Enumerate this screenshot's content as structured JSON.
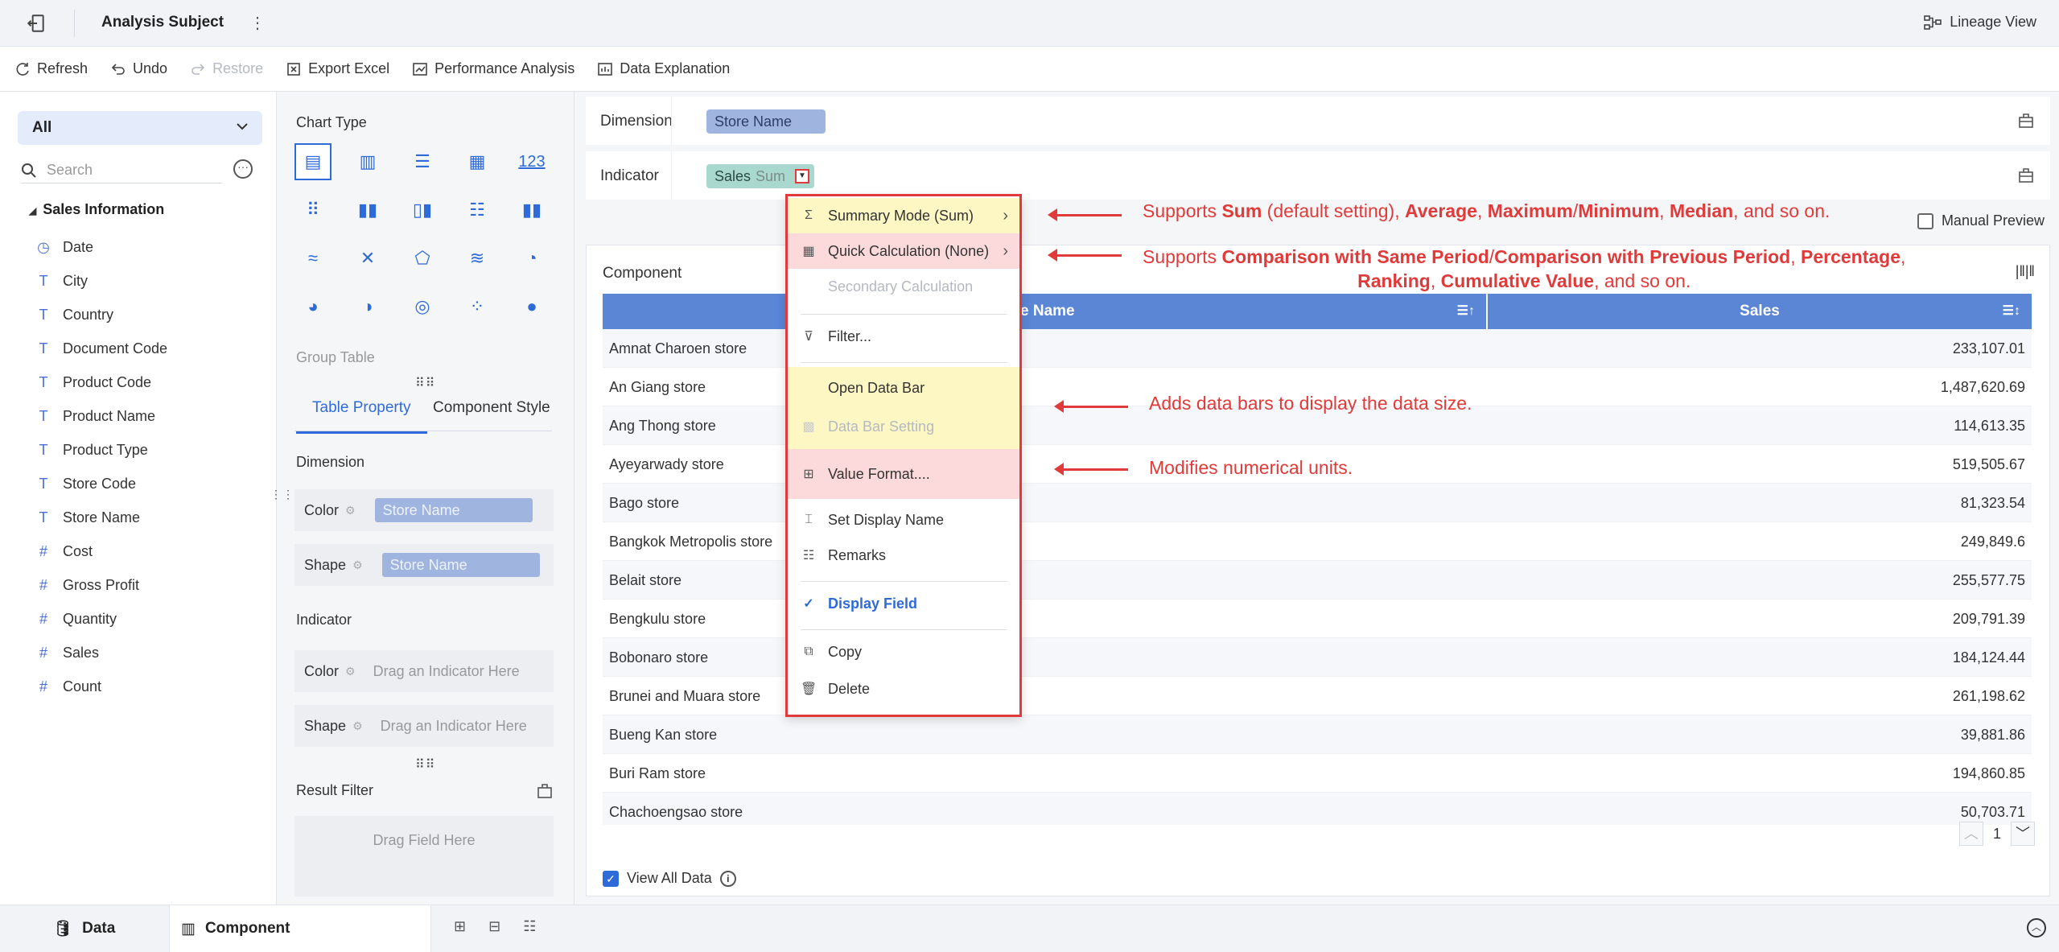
{
  "window": {
    "title": "Analysis Subject",
    "lineage_label": "Lineage View"
  },
  "toolbar": {
    "refresh": "Refresh",
    "undo": "Undo",
    "restore": "Restore",
    "export_excel": "Export Excel",
    "performance_analysis": "Performance Analysis",
    "data_explanation": "Data Explanation"
  },
  "left_panel": {
    "scope_select": "All",
    "search_placeholder": "Search",
    "folder": "Sales Information",
    "fields": [
      {
        "name": "Date",
        "type": "date"
      },
      {
        "name": "City",
        "type": "text"
      },
      {
        "name": "Country",
        "type": "text"
      },
      {
        "name": "Document Code",
        "type": "text"
      },
      {
        "name": "Product Code",
        "type": "text"
      },
      {
        "name": "Product Name",
        "type": "text"
      },
      {
        "name": "Product Type",
        "type": "text"
      },
      {
        "name": "Store Code",
        "type": "text"
      },
      {
        "name": "Store Name",
        "type": "text"
      },
      {
        "name": "Cost",
        "type": "number"
      },
      {
        "name": "Gross Profit",
        "type": "number"
      },
      {
        "name": "Quantity",
        "type": "number"
      },
      {
        "name": "Sales",
        "type": "number"
      },
      {
        "name": "Count",
        "type": "number-star"
      }
    ]
  },
  "mid_panel": {
    "chart_type_label": "Chart Type",
    "selected_chart": "Group Table",
    "tabs": {
      "table_property": "Table Property",
      "component_style": "Component Style"
    },
    "dimension_label": "Dimension",
    "indicator_label": "Indicator",
    "color_label": "Color",
    "shape_label": "Shape",
    "dimension_color_value": "Store Name",
    "dimension_shape_value": "Store Name",
    "indicator_drop_hint": "Drag an Indicator Here",
    "result_filter_label": "Result Filter",
    "result_filter_hint": "Drag Field Here"
  },
  "analysis": {
    "dimension_label": "Dimension",
    "dimension_pill": "Store Name",
    "indicator_label": "Indicator",
    "indicator_pill": "Sales",
    "indicator_pill_agg": "Sum",
    "manual_preview": "Manual Preview"
  },
  "component": {
    "title": "Component",
    "columns": [
      "Store Name",
      "Sales"
    ],
    "column_partial_visible": "ore Name",
    "rows": [
      [
        "Amnat Charoen store",
        "233,107.01"
      ],
      [
        "An Giang store",
        "1,487,620.69"
      ],
      [
        "Ang Thong store",
        "114,613.35"
      ],
      [
        "Ayeyarwady store",
        "519,505.67"
      ],
      [
        "Bago store",
        "81,323.54"
      ],
      [
        "Bangkok Metropolis store",
        "249,849.6"
      ],
      [
        "Belait store",
        "255,577.75"
      ],
      [
        "Bengkulu store",
        "209,791.39"
      ],
      [
        "Bobonaro store",
        "184,124.44"
      ],
      [
        "Brunei and Muara store",
        "261,198.62"
      ],
      [
        "Bueng Kan store",
        "39,881.86"
      ],
      [
        "Buri Ram store",
        "194,860.85"
      ],
      [
        "Chachoengsao store",
        "50,703.71"
      ]
    ],
    "page": "1",
    "view_all_data": "View All Data"
  },
  "context_menu": {
    "summary_mode": "Summary Mode (Sum)",
    "quick_calc": "Quick Calculation (None)",
    "secondary_calc": "Secondary Calculation",
    "filter": "Filter...",
    "open_data_bar": "Open Data Bar",
    "data_bar_setting": "Data Bar Setting",
    "value_format": "Value Format....",
    "set_display_name": "Set Display Name",
    "remarks": "Remarks",
    "display_field": "Display Field",
    "copy": "Copy",
    "delete": "Delete"
  },
  "annotations": {
    "a1": {
      "p1": "Supports ",
      "b1": "Sum",
      "p2": " (default setting), ",
      "b2": "Average",
      "p3": ", ",
      "b3": "Maximum",
      "p4": "/",
      "b4": "Minimum",
      "p5": ", ",
      "b5": "Median",
      "p6": ", and so on."
    },
    "a2": {
      "p1": "Supports ",
      "b1": "Comparison with Same Period",
      "p2": "/",
      "b2": "Comparison with Previous Period",
      "p3": ", ",
      "b3": "Percentage",
      "p4": ",",
      "b4": "Ranking",
      "p5": ", ",
      "b5": "Cumulative Value",
      "p6": ", and so on."
    },
    "a3": "Adds data bars to display the data size.",
    "a4": "Modifies numerical units."
  },
  "bottom_bar": {
    "data_tab": "Data",
    "component_tab": "Component"
  },
  "colors": {
    "accent": "#2f6bd8",
    "header_blue": "#5b86d6",
    "annotation_red": "#e03a3a",
    "highlight_yellow": "#fdf7c4",
    "highlight_pink": "#fcdadb"
  }
}
